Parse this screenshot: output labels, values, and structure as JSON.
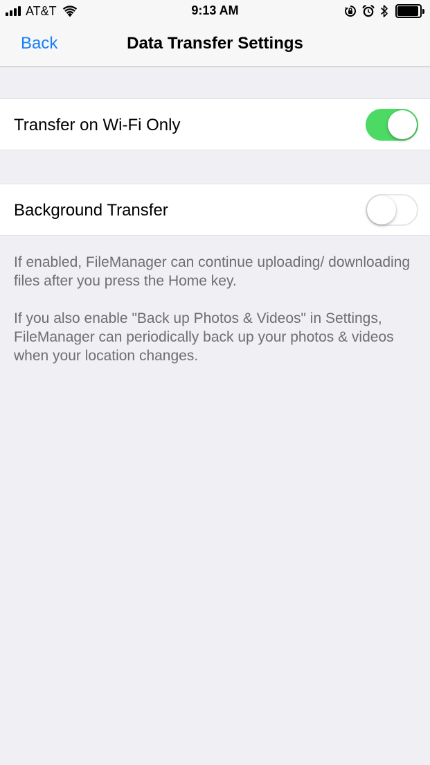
{
  "status_bar": {
    "carrier": "AT&T",
    "time": "9:13 AM",
    "battery_level": 0.95
  },
  "nav": {
    "back_label": "Back",
    "title": "Data Transfer Settings"
  },
  "settings": [
    {
      "label": "Transfer on Wi-Fi Only",
      "enabled": true
    },
    {
      "label": "Background Transfer",
      "enabled": false
    }
  ],
  "footer": {
    "paragraph_1": "If enabled, FileManager can continue uploading/ downloading files after you press the Home key.",
    "paragraph_2": "If you also enable \"Back up Photos & Videos\" in Settings, FileManager can periodically back up your photos & videos when your location changes."
  },
  "colors": {
    "accent": "#157efb",
    "toggle_on": "#4cd964",
    "background": "#efeff4"
  }
}
